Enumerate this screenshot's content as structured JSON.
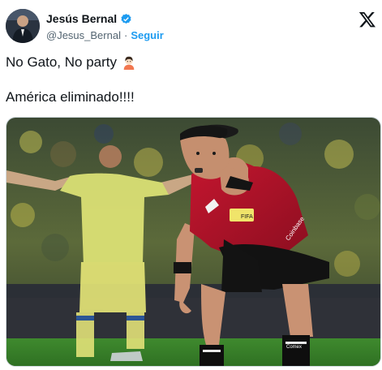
{
  "tweet": {
    "author_name": "Jesús Bernal",
    "author_handle": "@Jesus_Bernal",
    "separator": "·",
    "follow_label": "Seguir",
    "text_line1": "No Gato, No party",
    "text_line2": "América eliminado!!!!"
  },
  "icons": {
    "verified": "verified-badge-icon",
    "logo": "x-logo-icon",
    "emoji": "boy-emoji-icon"
  },
  "media": {
    "badge_text": "FIFA",
    "sponsor_text": "Coinbase",
    "sock_text": "Comex"
  },
  "colors": {
    "link": "#1d9bf0",
    "muted": "#536471",
    "referee_shirt": "#b0122a",
    "player_jersey": "#e9e86a"
  }
}
